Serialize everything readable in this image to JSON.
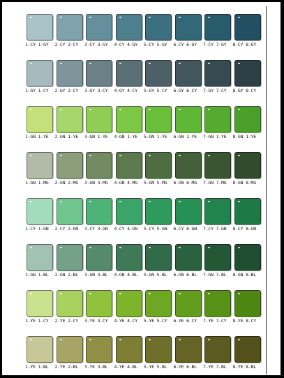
{
  "rows": [
    {
      "swatches": [
        {
          "label": "1-CY 1-GY",
          "color": "#a9c3c9"
        },
        {
          "label": "2-CY 2-CY",
          "color": "#7fa2ad"
        },
        {
          "label": "3-CY 3-GY",
          "color": "#64909c"
        },
        {
          "label": "4-CY 4-GY",
          "color": "#4d7f8c"
        },
        {
          "label": "5-CY 5-GY",
          "color": "#3c6f7f"
        },
        {
          "label": "6-CY 6-GY",
          "color": "#336878"
        },
        {
          "label": "7-CY 7-GY",
          "color": "#285c6d"
        },
        {
          "label": "8-CY 8-GY",
          "color": "#224f61"
        }
      ]
    },
    {
      "swatches": [
        {
          "label": "1-GY 1-CY",
          "color": "#a6b9bd"
        },
        {
          "label": "2-GY 2-CY",
          "color": "#7e959c"
        },
        {
          "label": "3-GY 3-CY",
          "color": "#6b8087"
        },
        {
          "label": "4-GY 4-CY",
          "color": "#5b6f77"
        },
        {
          "label": "5-GY 5-CY",
          "color": "#4d6068"
        },
        {
          "label": "6-GY 6-CY",
          "color": "#42565d"
        },
        {
          "label": "7-GY 7-CY",
          "color": "#384a51"
        },
        {
          "label": "8-GY 8-CY",
          "color": "#2f3f46"
        }
      ]
    },
    {
      "swatches": [
        {
          "label": "1-GN 1-YE",
          "color": "#c3e07a"
        },
        {
          "label": "2-GN 1-YE",
          "color": "#a6d66c"
        },
        {
          "label": "3-GN 1-YE",
          "color": "#8fcd55"
        },
        {
          "label": "4-GN 1-YE",
          "color": "#7cc745"
        },
        {
          "label": "5-GN 1-YE",
          "color": "#6bbd3c"
        },
        {
          "label": "6-GN 1-YE",
          "color": "#60b637"
        },
        {
          "label": "7-GN 1-YE",
          "color": "#55aa30"
        },
        {
          "label": "8-GN 1-YE",
          "color": "#4ba02c"
        }
      ]
    },
    {
      "swatches": [
        {
          "label": "1-GN 1-MG",
          "color": "#b2baa8"
        },
        {
          "label": "2-GN 2-MG",
          "color": "#8c9e7b"
        },
        {
          "label": "3-GN 3-MG",
          "color": "#738a63"
        },
        {
          "label": "4-GN 4-MG",
          "color": "#5d7a4f"
        },
        {
          "label": "5-GN 5-MG",
          "color": "#4f6d42"
        },
        {
          "label": "6-GN 6-MG",
          "color": "#43603a"
        },
        {
          "label": "7-GN 7-MG",
          "color": "#3a5532"
        },
        {
          "label": "8-GN 8-MG",
          "color": "#324b2c"
        }
      ]
    },
    {
      "swatches": [
        {
          "label": "1-CY 1-GN",
          "color": "#a3dcbb"
        },
        {
          "label": "2-CY 2-GN",
          "color": "#70c48e"
        },
        {
          "label": "3-CY 3-GN",
          "color": "#4eb376"
        },
        {
          "label": "4-CY 4-GN",
          "color": "#3aa566"
        },
        {
          "label": "5-CY 5-GN",
          "color": "#2e9a5b"
        },
        {
          "label": "6-CY 6-GN",
          "color": "#268f53"
        },
        {
          "label": "7-CY 7-GN",
          "color": "#21844c"
        },
        {
          "label": "8-CY 8-GN",
          "color": "#1d7a46"
        }
      ]
    },
    {
      "swatches": [
        {
          "label": "1-GN 1-BL",
          "color": "#a3c2b3"
        },
        {
          "label": "2-GN 2-BL",
          "color": "#74a188"
        },
        {
          "label": "3-GN 3-BL",
          "color": "#558a6b"
        },
        {
          "label": "4-GN 4-BL",
          "color": "#3e7a58"
        },
        {
          "label": "5-GN 5-BL",
          "color": "#326b4a"
        },
        {
          "label": "6-GN 6-BL",
          "color": "#2a613f"
        },
        {
          "label": "7-GN 7-BL",
          "color": "#245736"
        },
        {
          "label": "8-GN 8-BL",
          "color": "#1f4e30"
        }
      ]
    },
    {
      "swatches": [
        {
          "label": "1-YE 1-CY",
          "color": "#c9e290"
        },
        {
          "label": "2-YE 2-CY",
          "color": "#a8d15f"
        },
        {
          "label": "3-YE 3-CY",
          "color": "#90c23e"
        },
        {
          "label": "4-YE 4-CY",
          "color": "#7db42c"
        },
        {
          "label": "5-YE 5-CY",
          "color": "#6ea823"
        },
        {
          "label": "6-YE 6-CY",
          "color": "#639d1d"
        },
        {
          "label": "7-YE 7-CY",
          "color": "#589118"
        },
        {
          "label": "8-YE 8-CY",
          "color": "#4e8614"
        }
      ]
    },
    {
      "swatches": [
        {
          "label": "1-YE 1-BL",
          "color": "#c8c79a"
        },
        {
          "label": "2-YE 2-BL",
          "color": "#a6a566"
        },
        {
          "label": "3-YE 3-BL",
          "color": "#8f8f46"
        },
        {
          "label": "4-YE 4-BL",
          "color": "#7d7d36"
        },
        {
          "label": "5-YE 5-BL",
          "color": "#6f6f2c"
        },
        {
          "label": "6-YE 6-BL",
          "color": "#656426"
        },
        {
          "label": "7-YE 7-BL",
          "color": "#5b5a20"
        },
        {
          "label": "8-YE 8-BL",
          "color": "#52501b"
        }
      ]
    }
  ]
}
